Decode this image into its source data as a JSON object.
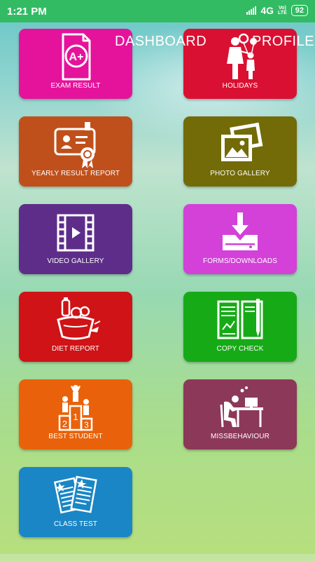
{
  "status": {
    "time": "1:21 PM",
    "network": "4G",
    "volte_top": "Vo)",
    "volte_bottom": "LTE",
    "battery": "92"
  },
  "nav": {
    "dashboard": "DASHBOARD",
    "profile": "PROFILE"
  },
  "tiles": [
    {
      "label": "EXAM RESULT",
      "icon": "exam-result-icon",
      "color": "#e5139b"
    },
    {
      "label": "HOLIDAYS",
      "icon": "family-balloons-icon",
      "color": "#da1033"
    },
    {
      "label": "YEARLY RESULT REPORT",
      "icon": "certificate-icon",
      "color": "#c0501b"
    },
    {
      "label": "PHOTO GALLERY",
      "icon": "photo-gallery-icon",
      "color": "#736b07"
    },
    {
      "label": "VIDEO GALLERY",
      "icon": "video-film-icon",
      "color": "#5e2d89"
    },
    {
      "label": "FORMS/DOWNLOADS",
      "icon": "download-icon",
      "color": "#d341d8"
    },
    {
      "label": "DIET REPORT",
      "icon": "food-basket-icon",
      "color": "#cf1316"
    },
    {
      "label": "COPY CHECK",
      "icon": "open-notebook-icon",
      "color": "#17aa17"
    },
    {
      "label": "BEST STUDENT",
      "icon": "podium-icon",
      "color": "#e9620b"
    },
    {
      "label": "MISSBEHAVIOUR",
      "icon": "sad-student-desk-icon",
      "color": "#8c3859"
    },
    {
      "label": "CLASS TEST",
      "icon": "test-papers-icon",
      "color": "#1a86c5"
    }
  ],
  "podium": {
    "first": "1",
    "second": "2",
    "third": "3"
  }
}
